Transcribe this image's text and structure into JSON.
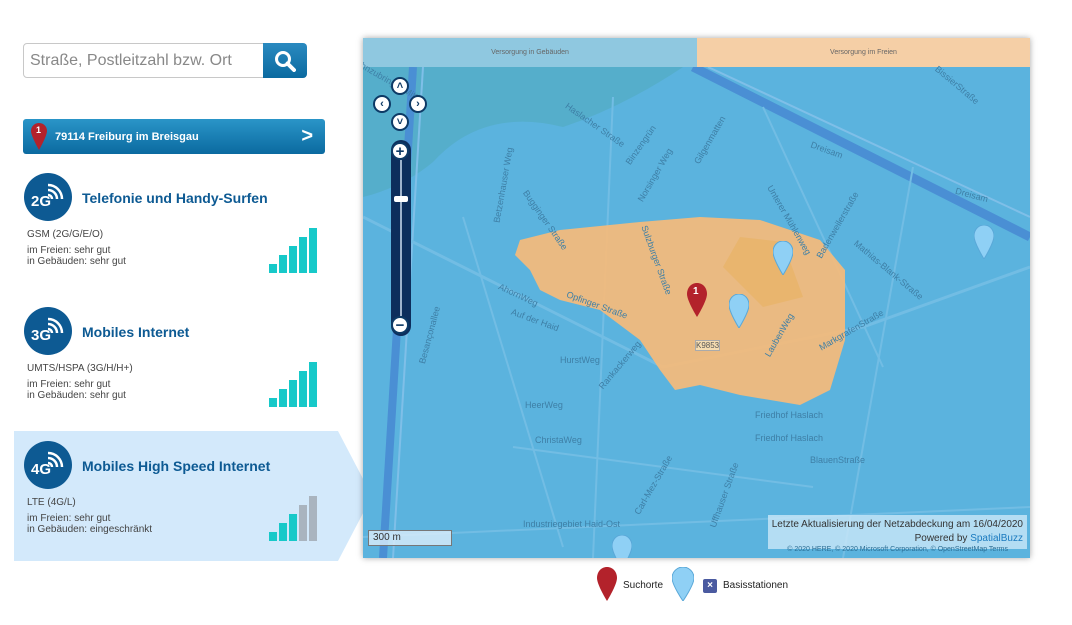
{
  "search": {
    "placeholder": "Straße, Postleitzahl bzw. Ort",
    "icon": "search-icon"
  },
  "location": {
    "pin_number": "1",
    "label": "79114 Freiburg im Breisgau",
    "chevron": ">"
  },
  "colors": {
    "primary": "#0d5a93",
    "bar_good": "#17c9c9",
    "bar_off": "#a9b4bf",
    "indoor_tab": "#8fc8e0",
    "outdoor_tab": "#f5cfa6",
    "coverage_outdoor": "#f6bb7a",
    "map_water": "#5bb3de"
  },
  "networks": [
    {
      "badge": "2G",
      "title": "Telefonie und Handy-Surfen",
      "tech": "GSM (2G/G/E/O)",
      "outdoor": "im Freien: sehr gut",
      "indoor": "in Gebäuden: sehr gut",
      "signal_level": 5,
      "signal_max": 5,
      "active": false
    },
    {
      "badge": "3G",
      "title": "Mobiles Internet",
      "tech": "UMTS/HSPA (3G/H/H+)",
      "outdoor": "im Freien: sehr gut",
      "indoor": "in Gebäuden: sehr gut",
      "signal_level": 5,
      "signal_max": 5,
      "active": false
    },
    {
      "badge": "4G",
      "title": "Mobiles High Speed Internet",
      "tech": "LTE (4G/L)",
      "outdoor": "im Freien: sehr gut",
      "indoor": "in Gebäuden: eingeschränkt",
      "signal_level": 3,
      "signal_max": 5,
      "active": true
    }
  ],
  "map": {
    "tabs": [
      {
        "label": "Versorgung in Gebäuden",
        "active": false
      },
      {
        "label": "Versorgung im Freien",
        "active": true
      }
    ],
    "scale": "300 m",
    "update_text": "Letzte Aktualisierung der Netzabdeckung am 16/04/2020",
    "powered_by": "Powered by",
    "powered_link": "SpatialBuzz",
    "copyright": "© 2020 HERE, © 2020 Microsoft Corporation, © OpenStreetMap  Terms",
    "search_pin_number": "1",
    "street_labels": [
      "Autobahnzubringer Mitte",
      "Haslacher Straße",
      "Dreisam",
      "Dreisam",
      "Besançonallee",
      "Opfinger Straße",
      "AhornWeg",
      "Auf der Haid",
      "Betzenhauser Weg",
      "Bugginger Straße",
      "Sulzburger Straße",
      "Norsinger Weg",
      "Gilgenmatten",
      "Binzengrün",
      "Unterer Mühlenweg",
      "Badenweilerstraße",
      "Mathias-Blank-Straße",
      "MarkgrafenStraße",
      "LaubenWeg",
      "K9853",
      "Friedhof Haslach",
      "Friedhof Haslach",
      "BlauenStraße",
      "HurstWeg",
      "HeerWeg",
      "ChristaWeg",
      "Industriegebiet Haid-Ost",
      "Uffhauser Straße",
      "Carl-Mez-Straße",
      "BissierStraße",
      "Rankackerweg"
    ]
  },
  "legend": {
    "search_locations": "Suchorte",
    "base_stations": "Basisstationen"
  }
}
